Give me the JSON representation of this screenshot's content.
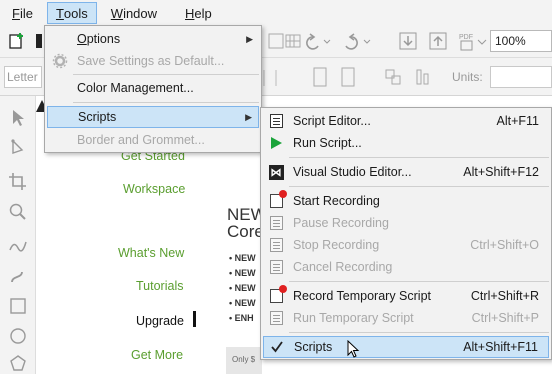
{
  "menubar": {
    "items": [
      {
        "label": "File",
        "u": "F",
        "rest": "ile"
      },
      {
        "label": "Tools",
        "u": "T",
        "rest": "ools"
      },
      {
        "label": "Window",
        "u": "W",
        "rest": "indow"
      },
      {
        "label": "Help",
        "u": "H",
        "rest": "elp"
      }
    ]
  },
  "toolbar": {
    "zoom": "100%",
    "letter_placeholder": "Letter",
    "units_label": "Units:"
  },
  "welcome": {
    "nav": [
      "Get Started",
      "Workspace",
      "What's New",
      "Tutorials",
      "Upgrade",
      "Get More"
    ],
    "news_title_1": "NEW",
    "news_title_2": "Core",
    "bullets": [
      "NEW",
      "NEW",
      "NEW",
      "NEW",
      "ENH"
    ],
    "promo": "Only $"
  },
  "tools_menu": {
    "items": [
      {
        "label": "Options",
        "disabled": false,
        "submenu": true
      },
      {
        "label": "Save Settings as Default...",
        "disabled": true
      },
      {
        "label": "Color Management...",
        "disabled": false
      },
      {
        "label": "Scripts",
        "disabled": false,
        "submenu": true,
        "highlighted": true
      },
      {
        "label": "Border and Grommet...",
        "disabled": true
      }
    ]
  },
  "scripts_menu": {
    "items": [
      {
        "label": "Script Editor...",
        "shortcut": "Alt+F11",
        "disabled": false,
        "icon": "script-editor-icon"
      },
      {
        "label": "Run Script...",
        "shortcut": "",
        "disabled": false,
        "icon": "run-script-icon"
      },
      {
        "label": "Visual Studio Editor...",
        "shortcut": "Alt+Shift+F12",
        "disabled": false,
        "icon": "visual-studio-icon"
      },
      {
        "label": "Start Recording",
        "shortcut": "",
        "disabled": false,
        "icon": "start-recording-icon"
      },
      {
        "label": "Pause Recording",
        "shortcut": "",
        "disabled": true,
        "icon": "pause-recording-icon"
      },
      {
        "label": "Stop Recording",
        "shortcut": "Ctrl+Shift+O",
        "disabled": true,
        "icon": "stop-recording-icon"
      },
      {
        "label": "Cancel Recording",
        "shortcut": "",
        "disabled": true,
        "icon": "cancel-recording-icon"
      },
      {
        "label": "Record Temporary Script",
        "shortcut": "Ctrl+Shift+R",
        "disabled": false,
        "icon": "record-temp-script-icon"
      },
      {
        "label": "Run Temporary Script",
        "shortcut": "Ctrl+Shift+P",
        "disabled": true,
        "icon": "run-temp-script-icon"
      },
      {
        "label": "Scripts",
        "shortcut": "Alt+Shift+F11",
        "disabled": false,
        "checked": true,
        "highlighted": true,
        "icon": "checkmark-icon"
      }
    ]
  },
  "colors": {
    "highlight_bg": "#cce4f7",
    "highlight_border": "#7eb4ea",
    "nav_green": "#5a9e2f",
    "run_green": "#1aa33a",
    "record_red": "#e02020"
  }
}
